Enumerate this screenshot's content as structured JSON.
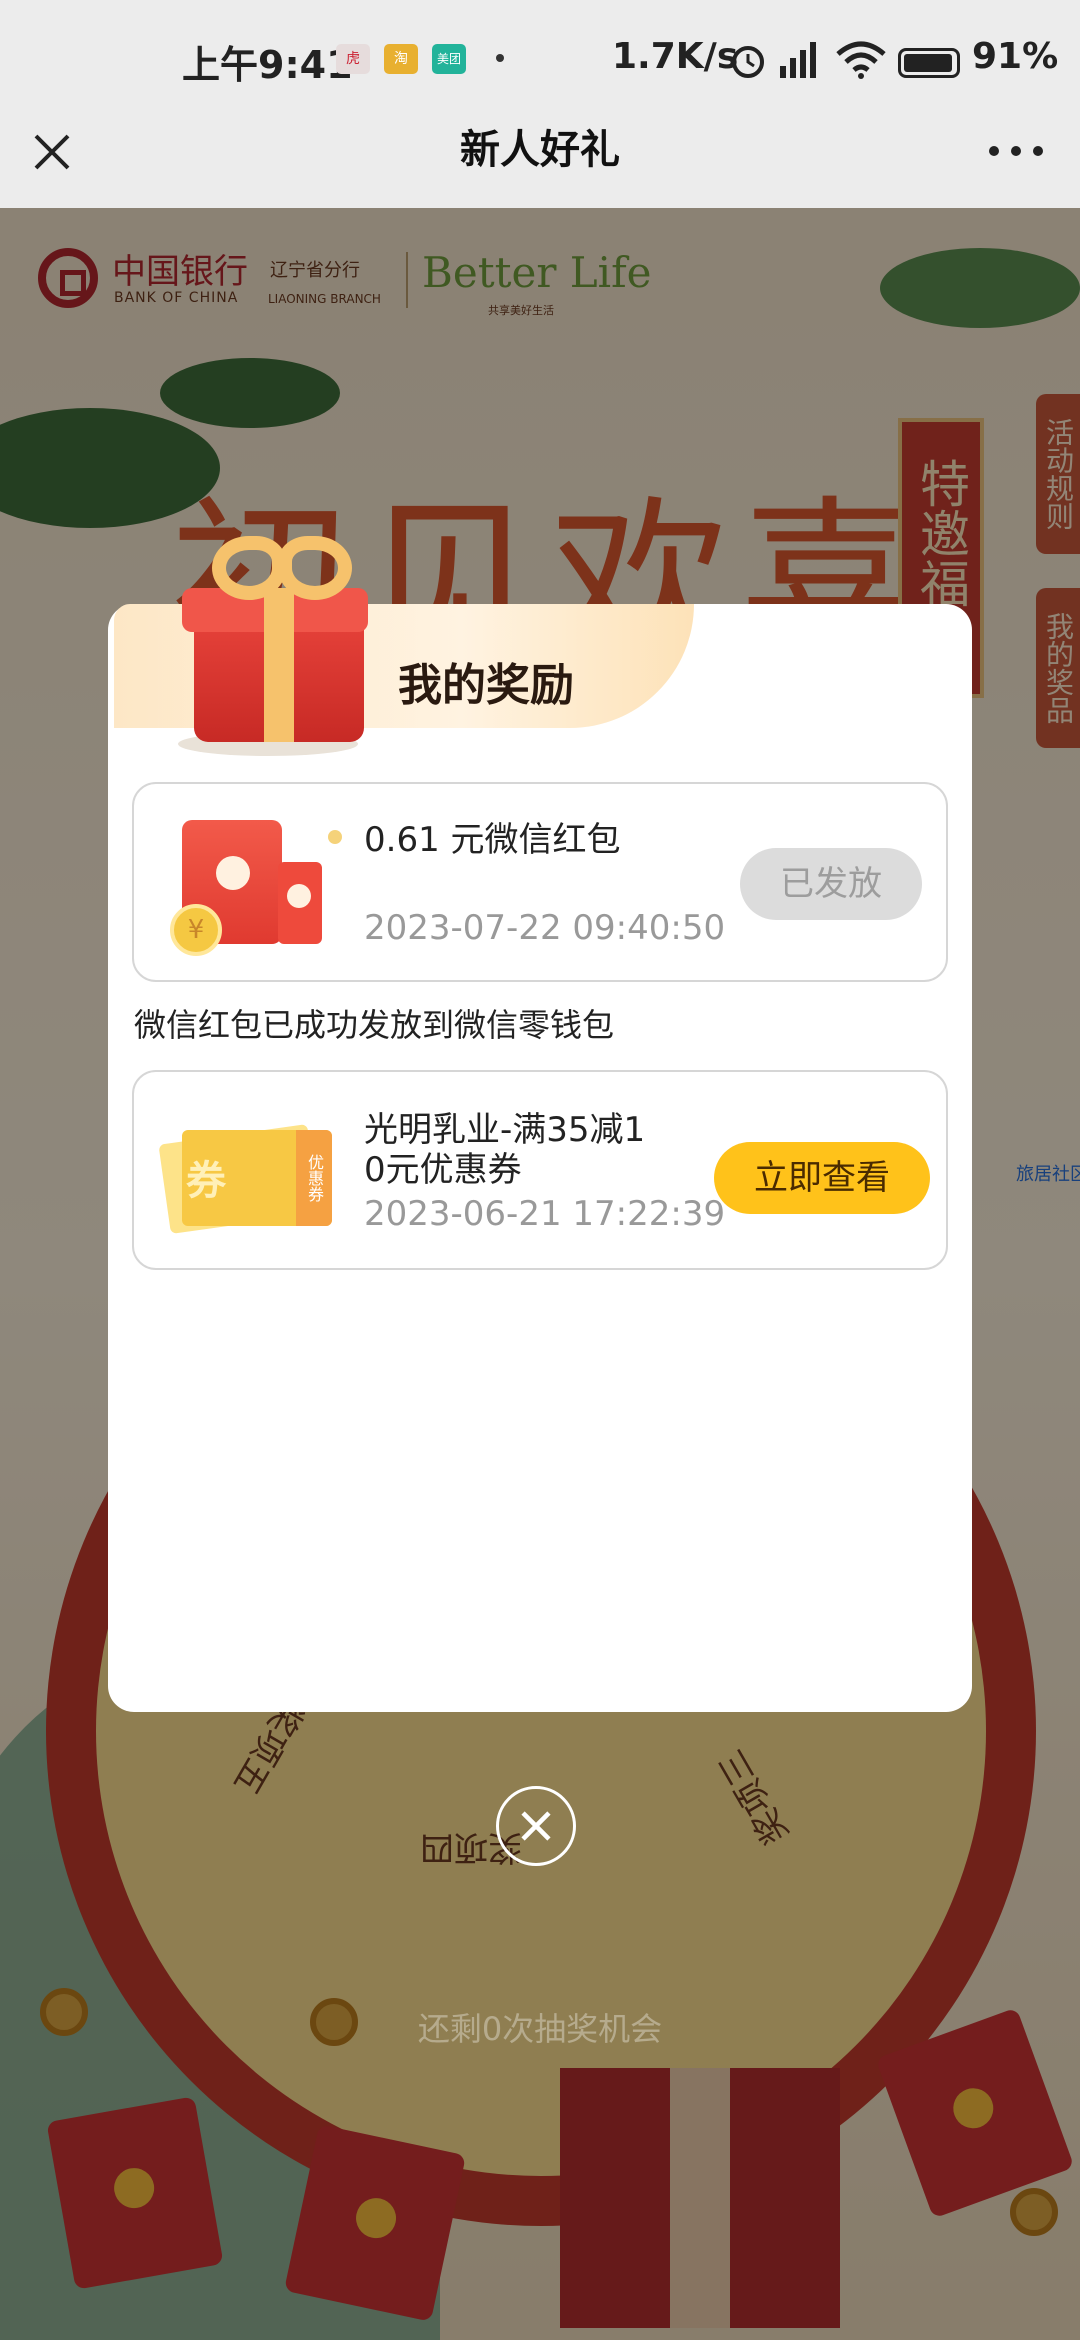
{
  "status_bar": {
    "time": "上午9:41",
    "net_speed": "1.7K/s",
    "battery": "91%",
    "notifications": [
      {
        "icon": "news-app-icon",
        "color": "#e8e0e0",
        "text": "虎"
      },
      {
        "icon": "taobao-app-icon",
        "color": "#e8b030",
        "text": "淘"
      },
      {
        "icon": "meituan-app-icon",
        "color": "#22b39a",
        "text": "美团"
      }
    ]
  },
  "nav": {
    "title": "新人好礼"
  },
  "background": {
    "bank_name": "中国银行",
    "bank_name_en": "BANK OF CHINA",
    "branch": "辽宁省分行",
    "branch_en": "LIAONING BRANCH",
    "slogan": "Better Life",
    "slogan_sub": "共享美好生活",
    "headline": "初见欢喜",
    "scroll_text": "特邀福礼",
    "side_tabs": [
      "活动规则",
      "我的奖品"
    ],
    "wheel_labels": [
      "奖项五",
      "奖项四",
      "奖项三"
    ],
    "community_link": "旅居社区",
    "remaining": "还剩0次抽奖机会"
  },
  "modal": {
    "title": "我的奖励",
    "rewards": [
      {
        "name": "0.61 元微信红包",
        "date": "2023-07-22 09:40:50",
        "button": "已发放",
        "icon": "red-envelope-icon"
      },
      {
        "name": "光明乳业-满35减10元优惠券",
        "name_line1": "光明乳业-满35减1",
        "name_line2": "0元优惠券",
        "date": "2023-06-21 17:22:39",
        "button": "立即查看",
        "icon": "coupon-icon",
        "coupon_label": "券",
        "coupon_stub": "优惠券"
      }
    ],
    "notice": "微信红包已成功发放到微信零钱包"
  },
  "colors": {
    "primary_button": "#ffc21a",
    "disabled_button": "#dcdcdc",
    "brand_red": "#b0272d"
  }
}
